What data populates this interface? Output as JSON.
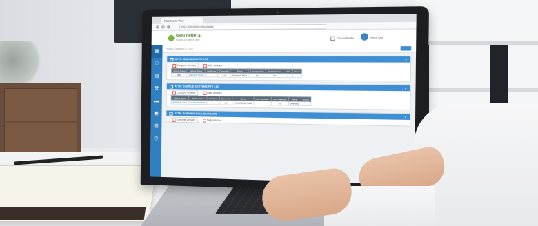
{
  "browser": {
    "tab_title": "RiskSheild View",
    "url": "https://riskshield.net/portal/list"
  },
  "app": {
    "logo_text": "SHIELDPORTAL",
    "logo_subtitle": "Transport & Workplace Safety",
    "header_link": "Choose Profile",
    "username": "Admin user"
  },
  "breadcrumb": "ASSESSMENTS LIST",
  "sidebar_icons": [
    "grid-icon",
    "users-icon",
    "document-icon",
    "wrench-icon",
    "folder-icon",
    "clipboard-icon",
    "chart-icon",
    "clock-icon"
  ],
  "cards": [
    {
      "title": "ATTN: RISK SIGN PTY LTD",
      "tabs": [
        "Complete Vehicles",
        "Daily Vehicles"
      ],
      "columns": [
        "Vehicle Name",
        "Vehicle Status",
        "Certificate",
        "Ownership",
        "Rating",
        "Last Inspection",
        "Next Inspection",
        "Alerts",
        "Result"
      ],
      "rows": [
        [
          "PMG",
          "SERVICE DONE",
          "↓",
          "pdf",
          "Sandtrack NSW",
          "16",
          "60",
          "0",
          ""
        ]
      ]
    },
    {
      "title": "ATTN: SAMPLE SYSTEMS PTY LTD",
      "tabs": [
        "Complete Vehicles",
        "Daily Vehicles"
      ],
      "columns": [
        "Vehicle Name",
        "Vehicle Status",
        "Certificate",
        "Ownership",
        "Rating",
        "Last Inspection",
        "Next Inspection",
        "Alerts",
        "Result"
      ],
      "rows": [
        [
          "BISKIT PH 3011",
          "SERVICE DONE",
          "↓",
          "pdf",
          "SANDTRACK NSW",
          "",
          "30",
          "APPROV",
          ""
        ]
      ]
    },
    {
      "title": "ATTN: BURNING BULL BURGERS",
      "tabs": [
        "Complete Vehicles",
        "Daily Vehicles"
      ],
      "columns": [],
      "rows": []
    }
  ]
}
